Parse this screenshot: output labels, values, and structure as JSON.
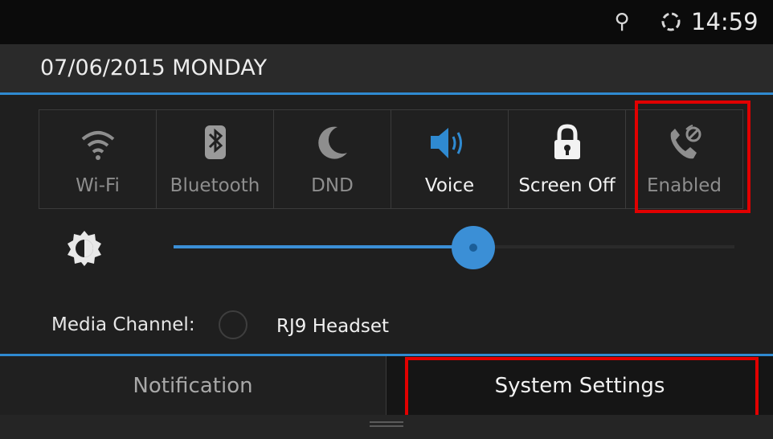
{
  "status": {
    "usb_icon": "usb-icon",
    "sync_icon": "sync-icon",
    "time": "14:59"
  },
  "header": {
    "date": "07/06/2015 MONDAY"
  },
  "quick_toggles": [
    {
      "label": "Wi-Fi",
      "icon": "wifi-icon",
      "active": false
    },
    {
      "label": "Bluetooth",
      "icon": "bluetooth-icon",
      "active": false
    },
    {
      "label": "DND",
      "icon": "moon-icon",
      "active": false
    },
    {
      "label": "Voice",
      "icon": "speaker-icon",
      "active": true
    },
    {
      "label": "Screen Off",
      "icon": "lock-icon",
      "active": true
    },
    {
      "label": "Enabled",
      "icon": "phone-block-icon",
      "active": false
    }
  ],
  "brightness": {
    "icon": "brightness-icon",
    "level_percent": 56
  },
  "media_channel": {
    "label": "Media Channel:",
    "option": "RJ9 Headset"
  },
  "tabs": {
    "notification": "Notification",
    "system_settings": "System Settings"
  },
  "colors": {
    "accent": "#2f8ad1",
    "highlight": "#e10000",
    "background": "#1f1f1f"
  }
}
